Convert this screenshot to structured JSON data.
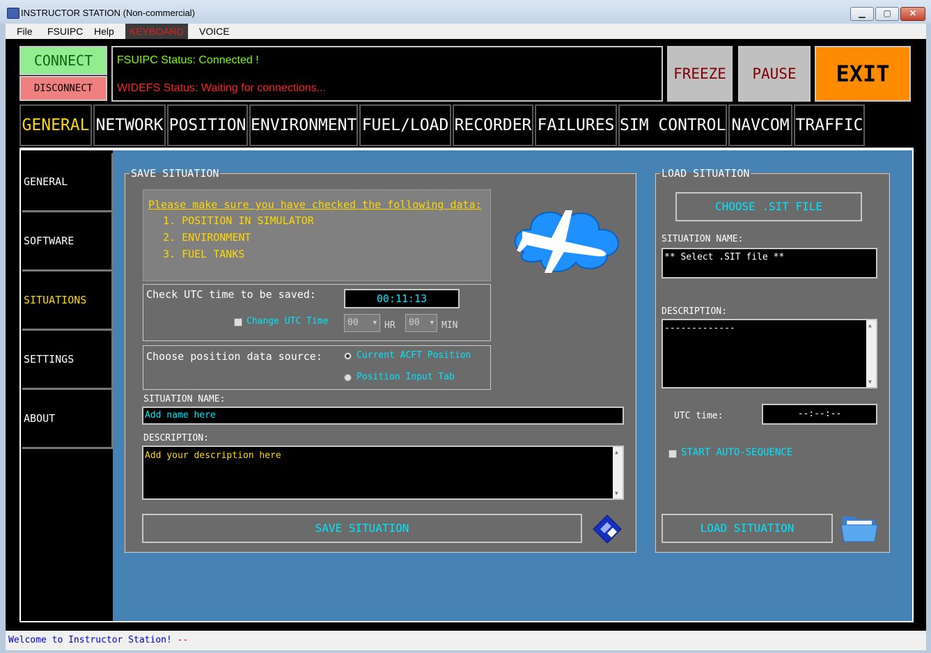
{
  "window": {
    "title": "INSTRUCTOR STATION (Non-commercial)",
    "min": "▁",
    "max": "▢",
    "close": "✕"
  },
  "menu": [
    {
      "label": "File"
    },
    {
      "label": "FSUIPC"
    },
    {
      "label": "Help"
    },
    {
      "label": "KEYBOARD"
    },
    {
      "label": "VOICE"
    }
  ],
  "top": {
    "connect": "CONNECT",
    "disconnect": "DISCONNECT",
    "fsuipc_status": "FSUIPC Status: Connected !",
    "widefs_status": "WIDEFS Status: Waiting for connections...",
    "freeze": "FREEZE",
    "pause": "PAUSE",
    "exit": "EXIT"
  },
  "tabs": [
    {
      "label": "GENERAL"
    },
    {
      "label": "NETWORK"
    },
    {
      "label": "POSITION"
    },
    {
      "label": "ENVIRONMENT"
    },
    {
      "label": "FUEL/LOAD"
    },
    {
      "label": "RECORDER"
    },
    {
      "label": "FAILURES"
    },
    {
      "label": "SIM CONTROL"
    },
    {
      "label": "NAVCOM"
    },
    {
      "label": "TRAFFIC"
    }
  ],
  "sidebar": [
    {
      "label": "GENERAL"
    },
    {
      "label": "SOFTWARE"
    },
    {
      "label": "SITUATIONS"
    },
    {
      "label": "SETTINGS"
    },
    {
      "label": "ABOUT"
    }
  ],
  "save": {
    "legend": "SAVE SITUATION",
    "notice": "Please make sure you have checked the following data:",
    "items": [
      "1. POSITION IN SIMULATOR",
      "2. ENVIRONMENT",
      "3. FUEL TANKS"
    ],
    "utc_label": "Check UTC time to be saved:",
    "utc_value": "00:11:13",
    "change_utc": "Change UTC Time",
    "hr_value": "00",
    "hr_label": "HR",
    "min_value": "00",
    "min_label": "MIN",
    "source_label": "Choose position data source:",
    "source_current": "Current ACFT Position",
    "source_input": "Position Input Tab",
    "name_label": "SITUATION NAME:",
    "name_value": "Add name here",
    "desc_label": "DESCRIPTION:",
    "desc_value": "Add your description here",
    "button": "SAVE SITUATION"
  },
  "load": {
    "legend": "LOAD SITUATION",
    "choose": "CHOOSE .SIT FILE",
    "name_label": "SITUATION NAME:",
    "name_value": "** Select .SIT file **",
    "desc_label": "DESCRIPTION:",
    "desc_value": "-------------",
    "utc_label": "UTC time:",
    "utc_value": "--:--:--",
    "auto_sequence": "START AUTO-SEQUENCE",
    "button": "LOAD SITUATION"
  },
  "status": {
    "message": "Welcome to Instructor Station!",
    "suffix": "--"
  },
  "icons": {
    "plane": "airplane-cloud-icon",
    "save": "floppy-disk-icon",
    "open": "folder-icon"
  },
  "colors": {
    "panel": "#6b6b6b",
    "content": "#4682b4",
    "yellow": "#ffd700",
    "cyan": "#00e5ff",
    "exit": "#ff8c00"
  }
}
